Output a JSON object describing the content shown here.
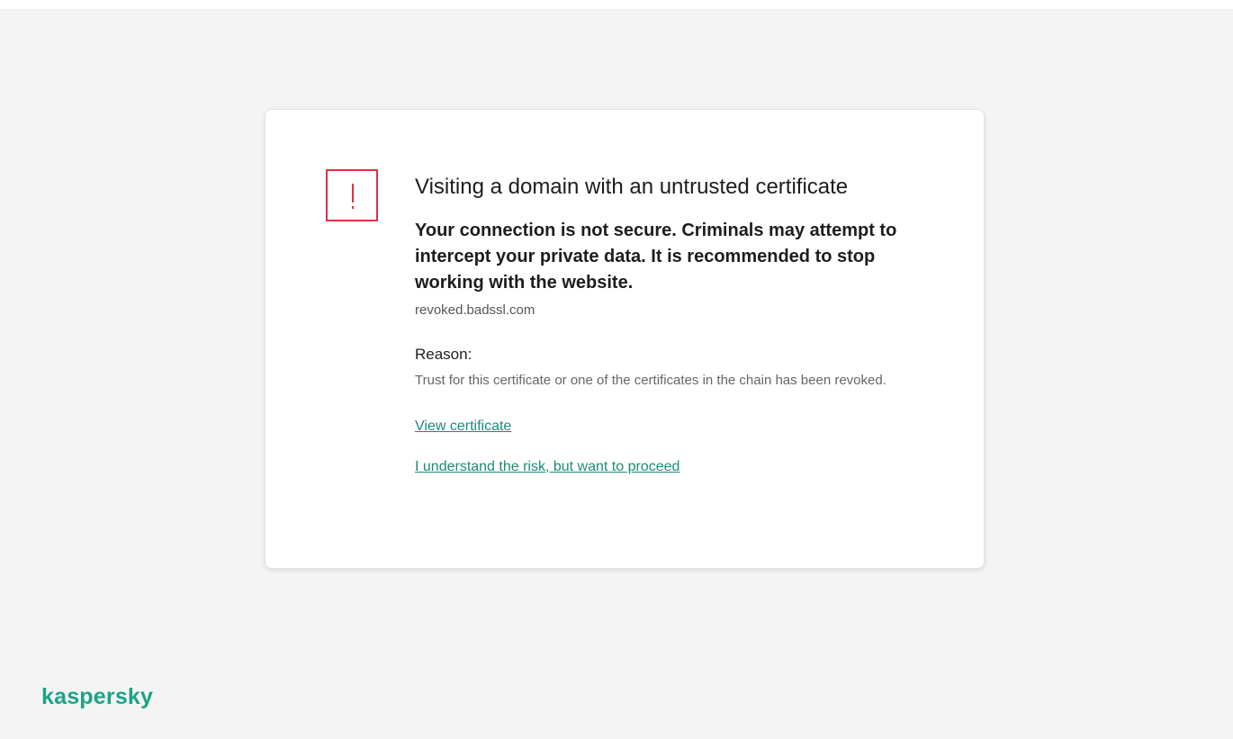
{
  "alert": {
    "title": "Visiting a domain with an untrusted certificate",
    "message": "Your connection is not secure. Criminals may attempt to intercept your private data. It is recommended to stop working with the website.",
    "domain": "revoked.badssl.com",
    "reason_label": "Reason:",
    "reason_text": "Trust for this certificate or one of the certificates in the chain has been revoked.",
    "view_certificate_link": "View certificate",
    "proceed_link": "I understand the risk, but want to proceed",
    "icon": "exclamation-warning-icon",
    "icon_color": "#e0313e"
  },
  "brand": {
    "logo_text": "kaspersky",
    "accent_color": "#1fa287"
  }
}
